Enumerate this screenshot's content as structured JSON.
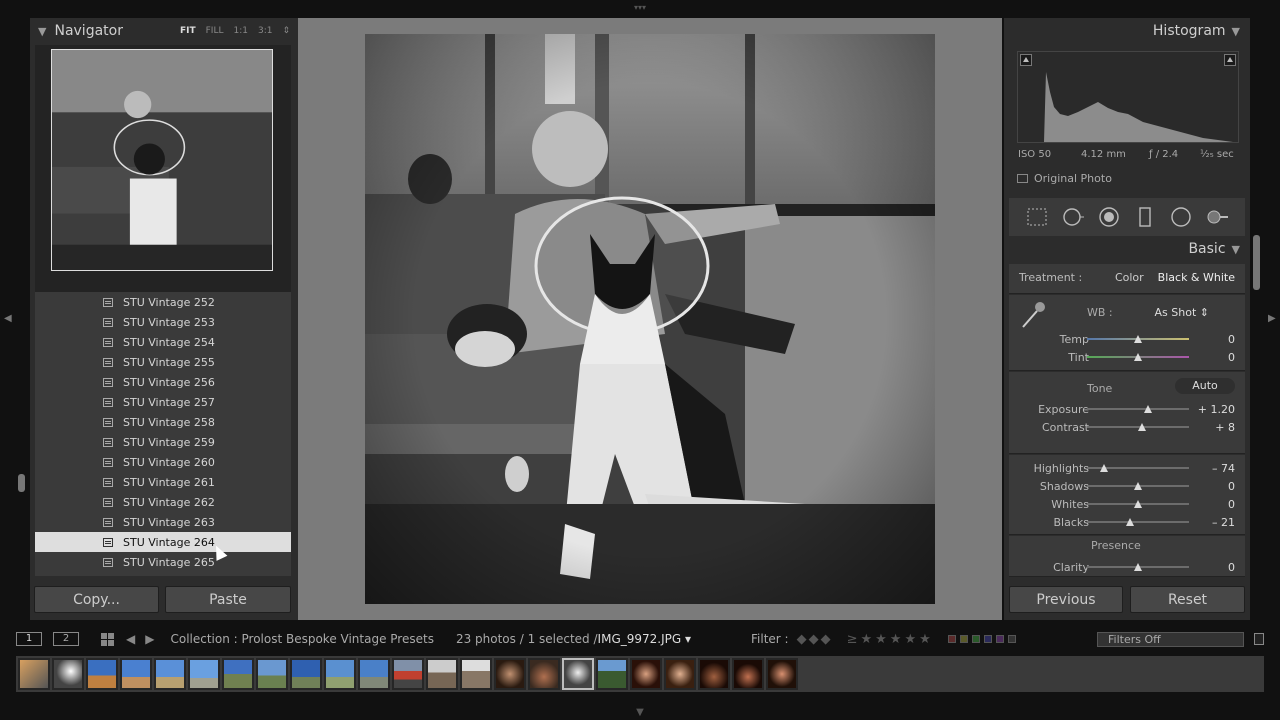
{
  "navigator": {
    "title": "Navigator",
    "options": [
      "FIT",
      "FILL",
      "1:1",
      "3:1"
    ],
    "active_option": "FIT"
  },
  "presets": [
    {
      "label": "STU Vintage 252",
      "selected": false
    },
    {
      "label": "STU Vintage 253",
      "selected": false
    },
    {
      "label": "STU Vintage 254",
      "selected": false
    },
    {
      "label": "STU Vintage 255",
      "selected": false
    },
    {
      "label": "STU Vintage 256",
      "selected": false
    },
    {
      "label": "STU Vintage 257",
      "selected": false
    },
    {
      "label": "STU Vintage 258",
      "selected": false
    },
    {
      "label": "STU Vintage 259",
      "selected": false
    },
    {
      "label": "STU Vintage 260",
      "selected": false
    },
    {
      "label": "STU Vintage 261",
      "selected": false
    },
    {
      "label": "STU Vintage 262",
      "selected": false
    },
    {
      "label": "STU Vintage 263",
      "selected": false
    },
    {
      "label": "STU Vintage 264",
      "selected": true
    },
    {
      "label": "STU Vintage 265",
      "selected": false
    }
  ],
  "left_buttons": {
    "copy": "Copy...",
    "paste": "Paste"
  },
  "histogram": {
    "title": "Histogram",
    "iso": "ISO 50",
    "focal": "4.12 mm",
    "aperture": "ƒ / 2.4",
    "shutter": "¹⁄₂₅ sec",
    "original_photo": "Original Photo"
  },
  "basic": {
    "title": "Basic",
    "treatment_label": "Treatment :",
    "treatment_color": "Color",
    "treatment_bw": "Black & White",
    "wb_label": "WB :",
    "wb_value": "As Shot ⇕",
    "tone_label": "Tone",
    "auto_label": "Auto",
    "presence_label": "Presence",
    "sliders": {
      "temp": {
        "label": "Temp",
        "value": "0",
        "pos": 0.5
      },
      "tint": {
        "label": "Tint",
        "value": "0",
        "pos": 0.5
      },
      "exposure": {
        "label": "Exposure",
        "value": "+ 1.20",
        "pos": 0.6
      },
      "contrast": {
        "label": "Contrast",
        "value": "+ 8",
        "pos": 0.54
      },
      "highlights": {
        "label": "Highlights",
        "value": "– 74",
        "pos": 0.17
      },
      "shadows": {
        "label": "Shadows",
        "value": "0",
        "pos": 0.5
      },
      "whites": {
        "label": "Whites",
        "value": "0",
        "pos": 0.5
      },
      "blacks": {
        "label": "Blacks",
        "value": "– 21",
        "pos": 0.42
      },
      "clarity": {
        "label": "Clarity",
        "value": "0",
        "pos": 0.5
      }
    }
  },
  "right_buttons": {
    "previous": "Previous",
    "reset": "Reset"
  },
  "filmstrip_bar": {
    "screen1": "1",
    "screen2": "2",
    "collection": "Collection : Prolost Bespoke Vintage Presets",
    "count": "23 photos / 1 selected /",
    "filename": "IMG_9972.JPG ▾",
    "filter_label": "Filter :",
    "filters_off": "Filters Off"
  },
  "colors": {
    "panel": "#2c2c2c",
    "subpanel": "#3a3a3a",
    "selected_row": "#dedede"
  },
  "icons": [
    "crop-icon",
    "spot-removal-icon",
    "red-eye-icon",
    "graduated-filter-icon",
    "radial-filter-icon",
    "adjustment-brush-icon",
    "eyedropper-icon"
  ]
}
